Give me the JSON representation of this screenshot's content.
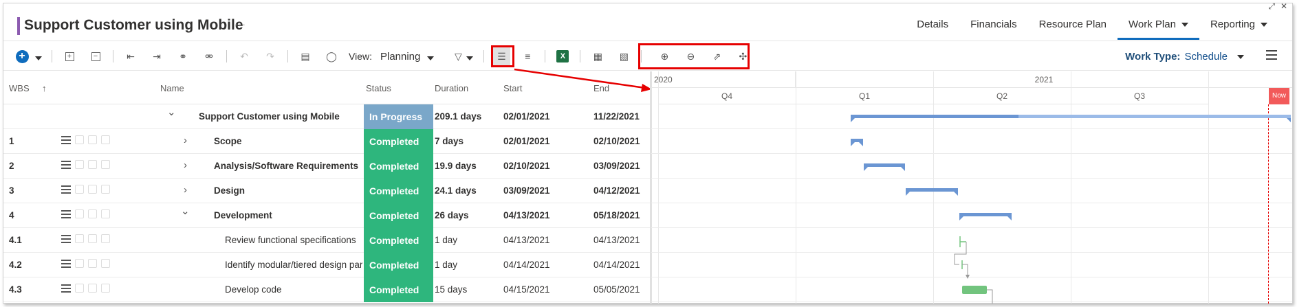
{
  "project": {
    "title": "Support Customer using Mobile",
    "more": "···"
  },
  "nav": {
    "items": [
      {
        "label": "Details"
      },
      {
        "label": "Financials"
      },
      {
        "label": "Resource Plan"
      },
      {
        "label": "Work Plan"
      },
      {
        "label": "Reporting"
      }
    ],
    "active": "Work Plan"
  },
  "toolbar": {
    "view_label": "View:",
    "view_value": "Planning",
    "work_type_label": "Work Type:",
    "work_type_value": "Schedule",
    "excel_letter": "X"
  },
  "grid": {
    "headers": {
      "wbs": "WBS",
      "sort": "↑",
      "name": "Name",
      "status": "Status",
      "duration": "Duration",
      "start": "Start",
      "end": "End"
    },
    "rows": [
      {
        "wbs": "",
        "name": "Support Customer using Mobile",
        "status": "In Progress",
        "duration": "209.1 days",
        "start": "02/01/2021",
        "end": "11/22/2021"
      },
      {
        "wbs": "1",
        "name": "Scope",
        "status": "Completed",
        "duration": "7 days",
        "start": "02/01/2021",
        "end": "02/10/2021"
      },
      {
        "wbs": "2",
        "name": "Analysis/Software Requirements",
        "status": "Completed",
        "duration": "19.9 days",
        "start": "02/10/2021",
        "end": "03/09/2021"
      },
      {
        "wbs": "3",
        "name": "Design",
        "status": "Completed",
        "duration": "24.1 days",
        "start": "03/09/2021",
        "end": "04/12/2021"
      },
      {
        "wbs": "4",
        "name": "Development",
        "status": "Completed",
        "duration": "26 days",
        "start": "04/13/2021",
        "end": "05/18/2021"
      },
      {
        "wbs": "4.1",
        "name": "Review functional specifications",
        "status": "Completed",
        "duration": "1 day",
        "start": "04/13/2021",
        "end": "04/13/2021"
      },
      {
        "wbs": "4.2",
        "name": "Identify modular/tiered design par",
        "status": "Completed",
        "duration": "1 day",
        "start": "04/14/2021",
        "end": "04/14/2021"
      },
      {
        "wbs": "4.3",
        "name": "Develop code",
        "status": "Completed",
        "duration": "15 days",
        "start": "04/15/2021",
        "end": "05/05/2021"
      }
    ]
  },
  "gantt": {
    "years": [
      "2020",
      "2021"
    ],
    "quarters": [
      "Q4",
      "Q1",
      "Q2",
      "Q3"
    ],
    "now_label": "Now",
    "colors": {
      "summary": "#6b96d3",
      "task": "#72c47e",
      "now": "#f25a5a",
      "in_progress": "#7aa7c9",
      "completed": "#2eb67d"
    }
  }
}
